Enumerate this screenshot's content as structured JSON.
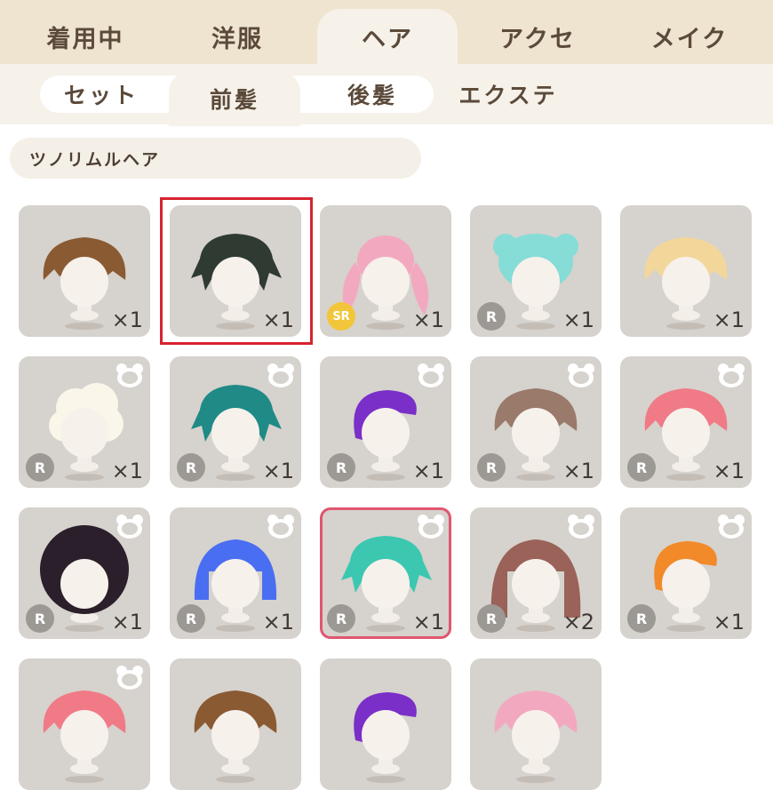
{
  "top_tabs": [
    "着用中",
    "洋服",
    "ヘア",
    "アクセ",
    "メイク"
  ],
  "top_tab_active": 2,
  "sub_tabs": [
    "セット",
    "前髪",
    "後髪",
    "エクステ"
  ],
  "sub_tab_active": 1,
  "item_name": "ツノリムルヘア",
  "items": [
    {
      "hair": "#8a5a33",
      "qty": "×1",
      "rarity": "",
      "wardrobe": false,
      "selected": false,
      "style": "short"
    },
    {
      "hair": "#2f3a33",
      "qty": "×1",
      "rarity": "",
      "wardrobe": false,
      "selected": false,
      "style": "messy"
    },
    {
      "hair": "#f2a9bf",
      "qty": "×1",
      "rarity": "SR",
      "wardrobe": false,
      "selected": false,
      "style": "twintail"
    },
    {
      "hair": "#86dcd6",
      "qty": "×1",
      "rarity": "R",
      "wardrobe": false,
      "selected": false,
      "style": "buns"
    },
    {
      "hair": "#f3d79a",
      "qty": "×1",
      "rarity": "",
      "wardrobe": false,
      "selected": false,
      "style": "short"
    },
    {
      "hair": "#fbf6ea",
      "qty": "×1",
      "rarity": "R",
      "wardrobe": true,
      "selected": false,
      "style": "afro"
    },
    {
      "hair": "#1f8a86",
      "qty": "×1",
      "rarity": "R",
      "wardrobe": true,
      "selected": false,
      "style": "messy"
    },
    {
      "hair": "#7a2fc8",
      "qty": "×1",
      "rarity": "R",
      "wardrobe": true,
      "selected": false,
      "style": "side"
    },
    {
      "hair": "#9a7a6a",
      "qty": "×1",
      "rarity": "R",
      "wardrobe": true,
      "selected": false,
      "style": "short"
    },
    {
      "hair": "#f07a86",
      "qty": "×1",
      "rarity": "R",
      "wardrobe": true,
      "selected": false,
      "style": "short"
    },
    {
      "hair": "#2a1f2a",
      "qty": "×1",
      "rarity": "R",
      "wardrobe": true,
      "selected": false,
      "style": "bowl"
    },
    {
      "hair": "#4a6ef2",
      "qty": "×1",
      "rarity": "R",
      "wardrobe": true,
      "selected": false,
      "style": "bob"
    },
    {
      "hair": "#3cc7b0",
      "qty": "×1",
      "rarity": "R",
      "wardrobe": true,
      "selected": true,
      "style": "messy"
    },
    {
      "hair": "#9a6258",
      "qty": "×2",
      "rarity": "R",
      "wardrobe": true,
      "selected": false,
      "style": "long"
    },
    {
      "hair": "#f28a2a",
      "qty": "×1",
      "rarity": "R",
      "wardrobe": true,
      "selected": false,
      "style": "side"
    },
    {
      "hair": "#f07a86",
      "qty": "",
      "rarity": "",
      "wardrobe": true,
      "selected": false,
      "style": "short"
    },
    {
      "hair": "#8a5a33",
      "qty": "",
      "rarity": "",
      "wardrobe": false,
      "selected": false,
      "style": "short"
    },
    {
      "hair": "#7a2fc8",
      "qty": "",
      "rarity": "",
      "wardrobe": false,
      "selected": false,
      "style": "side"
    },
    {
      "hair": "#f2a9bf",
      "qty": "",
      "rarity": "",
      "wardrobe": false,
      "selected": false,
      "style": "short"
    }
  ]
}
